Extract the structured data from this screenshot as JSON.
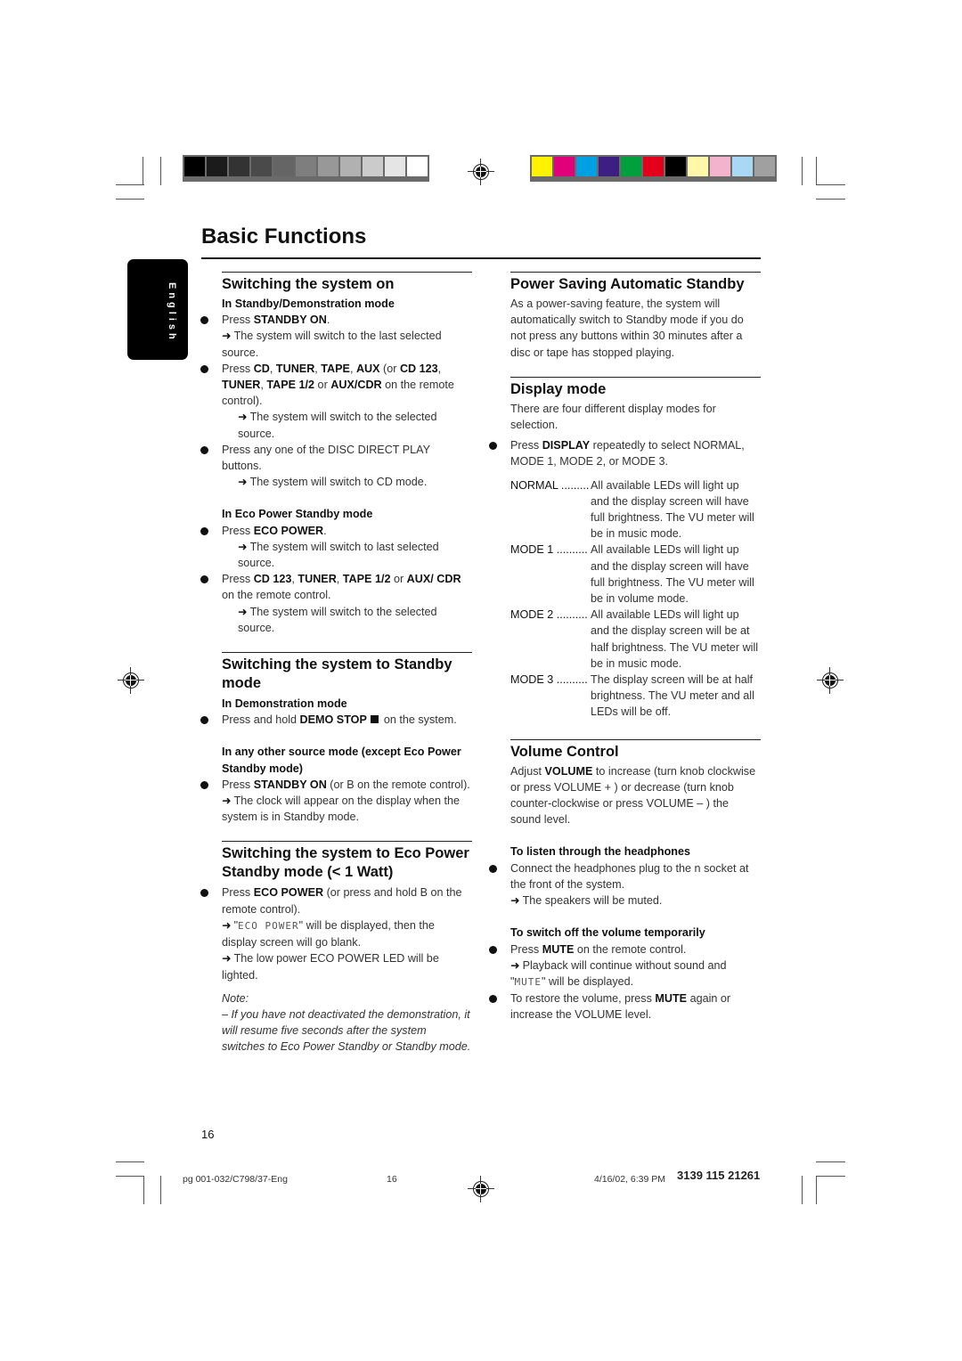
{
  "print_marks": {
    "gray_swatches": [
      "#000000",
      "#1b1b1b",
      "#333333",
      "#4a4a4a",
      "#656565",
      "#7e7e7e",
      "#989898",
      "#b1b1b1",
      "#cbcbcb",
      "#e5e5e5",
      "#ffffff"
    ],
    "color_swatches": [
      "#fff200",
      "#e2007a",
      "#00a0e3",
      "#3d1e82",
      "#00a03c",
      "#e2001a",
      "#000000",
      "#fff8a8",
      "#f4b3cc",
      "#a8d8f4",
      "#a0a0a0"
    ]
  },
  "page": {
    "title": "Basic Functions",
    "language_tab": "English",
    "page_number": "16"
  },
  "left": {
    "s1": {
      "heading": "Switching the system on",
      "sub1": "In Standby/Demonstration mode",
      "b1_pre": "Press ",
      "b1_bold": "STANDBY ON",
      "b1_post": ".",
      "r1": "The system will switch to the last selected source.",
      "b2_pre": "Press ",
      "b2_bold1": "CD",
      "b2_sep1": ", ",
      "b2_bold2": "TUNER",
      "b2_sep2": ", ",
      "b2_bold3": "TAPE",
      "b2_sep3": ", ",
      "b2_bold4": "AUX",
      "b2_sep4": " (or ",
      "b2_bold5": "CD 123",
      "b2_sep5": ", ",
      "b2_bold6": "TUNER",
      "b2_sep6": ", ",
      "b2_bold7": "TAPE 1/2",
      "b2_sep7": " or ",
      "b2_bold8": "AUX/CDR",
      "b2_post": " on the remote control).",
      "r2": "The system will switch to the selected source.",
      "b3": "Press any one of the DISC DIRECT PLAY buttons.",
      "r3": "The system will switch to CD mode.",
      "sub2": "In Eco Power Standby mode",
      "b4_pre": "Press ",
      "b4_bold": "ECO POWER",
      "b4_post": ".",
      "r4": "The system will switch to last selected source.",
      "b5_pre": "Press ",
      "b5_bold1": "CD 123",
      "b5_sep1": ", ",
      "b5_bold2": "TUNER",
      "b5_sep2": ", ",
      "b5_bold3": "TAPE 1/2",
      "b5_sep3": " or ",
      "b5_bold4": "AUX/ CDR",
      "b5_post": " on the remote control.",
      "r5": "The system will switch to the selected source."
    },
    "s2": {
      "heading": "Switching the system to Standby mode",
      "sub1": "In Demonstration mode",
      "b1_pre": "Press and hold ",
      "b1_bold": "DEMO STOP",
      "b1_post": "on the system.",
      "sub2": "In any other source mode (except Eco Power Standby mode)",
      "b2_pre": "Press ",
      "b2_bold": "STANDBY ON",
      "b2_post": " (or B   on the remote control).",
      "r1": "The clock will appear on the display when the system is in Standby mode."
    },
    "s3": {
      "heading": "Switching the system to Eco Power Standby mode (< 1 Watt)",
      "b1_pre": "Press ",
      "b1_bold": "ECO POWER",
      "b1_post": " (or press and hold B   on the remote control).",
      "r1_pre": "\"",
      "r1_lcd": "ECO POWER",
      "r1_post": "\" will be displayed, then the display screen will go blank.",
      "r2": "The low power ECO POWER LED will be lighted.",
      "note_label": "Note:",
      "note_text": "–  If you have not deactivated the demonstration, it will resume five seconds after the system switches to Eco Power Standby or Standby mode."
    }
  },
  "right": {
    "s1": {
      "heading": "Power Saving Automatic Standby",
      "body": "As a power-saving feature, the system will automatically switch to Standby mode if you do not press any buttons within 30 minutes after a disc or tape has stopped playing."
    },
    "s2": {
      "heading": "Display mode",
      "intro": "There are four different display modes for selection.",
      "b1_pre": "Press ",
      "b1_bold": "DISPLAY",
      "b1_post": " repeatedly to select NORMAL, MODE 1, MODE 2, or MODE 3.",
      "modes": [
        {
          "label": "NORMAL .........",
          "desc": "All available LEDs will light up and the display screen will have full brightness. The VU meter will be in music mode."
        },
        {
          "label": "MODE 1 ..........",
          "desc": "All available LEDs will light up and the display screen will have full brightness. The VU meter will be in volume mode."
        },
        {
          "label": "MODE 2 ..........",
          "desc": "All available LEDs will light up and the display screen will be at half brightness. The VU meter will be in music mode."
        },
        {
          "label": "MODE 3 ..........",
          "desc": "The display screen will be at half brightness. The VU meter and all LEDs will be off."
        }
      ]
    },
    "s3": {
      "heading": "Volume Control",
      "body_pre": "Adjust ",
      "body_bold": "VOLUME",
      "body_post": " to increase (turn knob clockwise or press VOLUME  + ) or decrease (turn knob counter-clockwise or press VOLUME  – ) the sound level.",
      "sub1": "To listen through the headphones",
      "b1": "Connect the headphones plug to the n   socket at the front of the system.",
      "r1": "The speakers will be muted.",
      "sub2": "To switch off the volume temporarily",
      "b2_pre": "Press ",
      "b2_bold": "MUTE",
      "b2_post": " on the remote control.",
      "r2_pre": "Playback will continue without sound and \"",
      "r2_lcd": "MUTE",
      "r2_post": "\" will be displayed.",
      "b3_pre": "To restore the volume, press ",
      "b3_bold": "MUTE",
      "b3_post": " again or increase the VOLUME level."
    }
  },
  "slug": {
    "file": "pg 001-032/C798/37-Eng",
    "page": "16",
    "datetime": "4/16/02, 6:39 PM",
    "code": "3139 115 21261"
  },
  "arrow": "➜"
}
